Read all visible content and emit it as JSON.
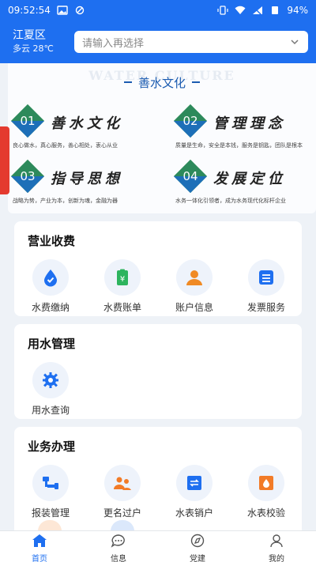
{
  "status_bar": {
    "time": "09:52:54",
    "battery": "94%"
  },
  "header": {
    "district": "江夏区",
    "weather": "多云 28℃",
    "search_placeholder": "请输入再选择"
  },
  "banner": {
    "title": "善水文化",
    "watermark": "WATER CULTURE",
    "items": [
      {
        "num": "01",
        "title": "善水文化",
        "subtitle": "良心做水，真心服务，善心相处，衷心从业"
      },
      {
        "num": "02",
        "title": "管理理念",
        "subtitle": "质量是生命，安全是本钱，服务是钥匙，团队是根本"
      },
      {
        "num": "03",
        "title": "指导思想",
        "subtitle": "战略为势，产业为本，创新为魂，金融为器"
      },
      {
        "num": "04",
        "title": "发展定位",
        "subtitle": "水务一体化引领者，成为水务现代化标杆企业"
      }
    ]
  },
  "sections": {
    "business_fee": {
      "title": "营业收费",
      "items": [
        "水费缴纳",
        "水费账单",
        "账户信息",
        "发票服务"
      ]
    },
    "water_mgmt": {
      "title": "用水管理",
      "items": [
        "用水查询"
      ]
    },
    "business_handle": {
      "title": "业务办理",
      "items": [
        "报装管理",
        "更名过户",
        "水表销户",
        "水表校验"
      ]
    }
  },
  "bottom_nav": [
    {
      "label": "首页",
      "icon": "home-icon",
      "active": true
    },
    {
      "label": "信息",
      "icon": "chat-icon",
      "active": false
    },
    {
      "label": "党建",
      "icon": "compass-icon",
      "active": false
    },
    {
      "label": "我的",
      "icon": "user-icon",
      "active": false
    }
  ],
  "colors": {
    "primary": "#1e6ff0",
    "banner_text": "#1b5bb0",
    "accent_orange": "#f27b27",
    "accent_green": "#2db45e"
  }
}
